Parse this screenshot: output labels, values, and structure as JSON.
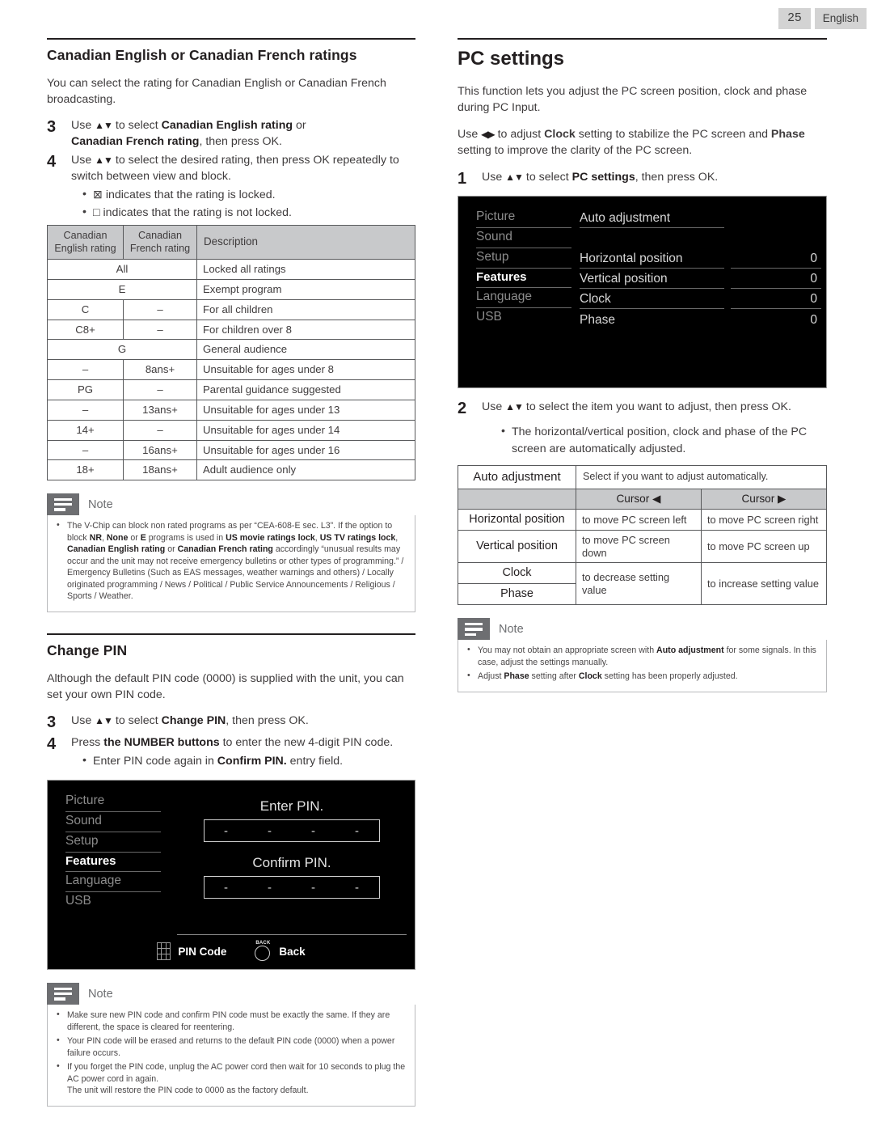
{
  "page": {
    "number": "25",
    "language": "English"
  },
  "left": {
    "section1": {
      "title": "Canadian English or Canadian French ratings",
      "intro": "You can select the rating for Canadian English or Canadian French broadcasting.",
      "steps": [
        {
          "num": "3",
          "html": "Use <span class=\"arrows\">▲▼</span> to select <b>Canadian English rating</b> or<br><b>Canadian French rating</b>, then press OK."
        },
        {
          "num": "4",
          "html": "Use <span class=\"arrows\">▲▼</span> to select the desired rating, then press OK repeatedly to switch between view and block."
        }
      ],
      "bullets": [
        "⊠ indicates that the rating is locked.",
        "□ indicates that the rating is not locked."
      ],
      "table": {
        "headers": [
          "Canadian\nEnglish rating",
          "Canadian\nFrench rating",
          "Description"
        ],
        "header_en": "Canadian English rating",
        "header_fr": "Canadian French rating",
        "header_desc": "Description",
        "rows": [
          {
            "span": true,
            "en": "All",
            "fr": "",
            "desc": "Locked all ratings"
          },
          {
            "span": true,
            "en": "E",
            "fr": "",
            "desc": "Exempt program"
          },
          {
            "span": false,
            "en": "C",
            "fr": "–",
            "desc": "For all children"
          },
          {
            "span": false,
            "en": "C8+",
            "fr": "–",
            "desc": "For children over 8"
          },
          {
            "span": true,
            "en": "G",
            "fr": "",
            "desc": "General audience"
          },
          {
            "span": false,
            "en": "–",
            "fr": "8ans+",
            "desc": "Unsuitable for ages under 8"
          },
          {
            "span": false,
            "en": "PG",
            "fr": "–",
            "desc": "Parental guidance suggested"
          },
          {
            "span": false,
            "en": "–",
            "fr": "13ans+",
            "desc": "Unsuitable for ages under 13"
          },
          {
            "span": false,
            "en": "14+",
            "fr": "–",
            "desc": "Unsuitable for ages under 14"
          },
          {
            "span": false,
            "en": "–",
            "fr": "16ans+",
            "desc": "Unsuitable for ages under 16"
          },
          {
            "span": false,
            "en": "18+",
            "fr": "18ans+",
            "desc": "Adult audience only"
          }
        ]
      },
      "note": {
        "title": "Note",
        "items": [
          "The V-Chip can block non rated programs as per “CEA-608-E sec. L3”. If the option to block <b>NR</b>, <b>None</b> or <b>E</b> programs is used in <b>US movie ratings lock</b>, <b>US TV ratings lock</b>, <b>Canadian English rating</b> or <b>Canadian French rating</b> accordingly “unusual results may occur and the unit may not receive emergency bulletins or other types of programming.” / Emergency Bulletins (Such as EAS messages, weather warnings and others) / Locally originated programming / News / Political / Public Service Announcements / Religious / Sports / Weather."
        ]
      }
    },
    "section2": {
      "title": "Change PIN",
      "intro": "Although the default PIN code (0000) is supplied with the unit, you can set your own PIN code.",
      "steps": [
        {
          "num": "3",
          "html": "Use <span class=\"arrows\">▲▼</span> to select <b>Change PIN</b>, then press OK."
        },
        {
          "num": "4",
          "html": "Press <b>the NUMBER buttons</b> to enter the new 4-digit PIN code."
        }
      ],
      "bullets": [
        "Enter PIN code again in <b>Confirm PIN.</b> entry field."
      ],
      "osd": {
        "menu": [
          "Picture",
          "Sound",
          "Setup",
          "Features",
          "Language",
          "USB"
        ],
        "selected": "Features",
        "enter_label": "Enter PIN.",
        "confirm_label": "Confirm PIN.",
        "digit": "-",
        "footer": [
          {
            "icon": "keypad-icon",
            "label": "PIN Code"
          },
          {
            "icon": "back-button-icon",
            "label": "Back",
            "tag": "BACK"
          }
        ]
      },
      "note": {
        "title": "Note",
        "items": [
          "Make sure new PIN code and confirm PIN code must be exactly the same. If they are different, the space is cleared for reentering.",
          "Your PIN code will be erased and returns to the default PIN code (0000) when a power failure occurs.",
          "If you forget the PIN code, unplug the AC power cord then wait for 10 seconds to plug the AC power cord in again.<br>The unit will restore the PIN code to 0000 as the factory default."
        ]
      }
    }
  },
  "right": {
    "title": "PC settings",
    "intro1": "This function lets you adjust the PC screen position, clock and phase during PC Input.",
    "intro2": "Use <span class=\"arrows\">◀▶</span> to adjust <b>Clock</b> setting to stabilize the PC screen and <b>Phase</b> setting to improve the clarity of the PC screen.",
    "step1": {
      "num": "1",
      "html": "Use <span class=\"arrows\">▲▼</span> to select <b>PC settings</b>, then  press OK."
    },
    "osd": {
      "menu": [
        "Picture",
        "Sound",
        "Setup",
        "Features",
        "Language",
        "USB"
      ],
      "selected": "Features",
      "rows": [
        {
          "label": "Auto adjustment",
          "value": ""
        },
        {
          "label": "Horizontal position",
          "value": "0"
        },
        {
          "label": "Vertical position",
          "value": "0"
        },
        {
          "label": "Clock",
          "value": "0"
        },
        {
          "label": "Phase",
          "value": "0"
        }
      ]
    },
    "step2": {
      "num": "2",
      "html": "Use <span class=\"arrows\">▲▼</span> to select the item you want to adjust, then press OK."
    },
    "step2_bullet": "The horizontal/vertical position, clock and phase of the PC screen are automatically adjusted.",
    "table": {
      "auto_label": "Auto adjustment",
      "auto_desc": "Select if you want to adjust automatically.",
      "cursor_left": "Cursor ◀",
      "cursor_right": "Cursor ▶",
      "rows": [
        {
          "item": "Horizontal position",
          "left": "to move PC screen left",
          "right": "to move PC screen right"
        },
        {
          "item": "Vertical position",
          "left": "to move PC screen down",
          "right": "to move PC screen up"
        }
      ],
      "clock_label": "Clock",
      "phase_label": "Phase",
      "clock_phase_left": "to decrease setting value",
      "clock_phase_right": "to increase setting value"
    },
    "note": {
      "title": "Note",
      "items": [
        "You may not obtain an appropriate screen with <b>Auto adjustment</b> for some signals. In this case, adjust the settings manually.",
        "Adjust <b>Phase</b> setting after <b>Clock</b> setting has been properly adjusted."
      ]
    }
  }
}
